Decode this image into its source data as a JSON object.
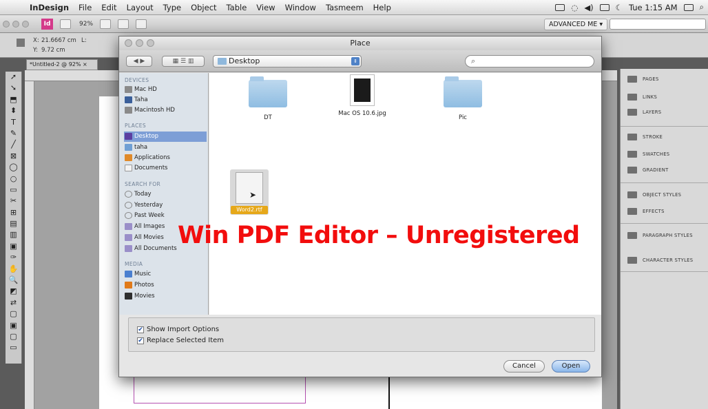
{
  "menubar": {
    "app_name": "InDesign",
    "items": [
      "File",
      "Edit",
      "Layout",
      "Type",
      "Object",
      "Table",
      "View",
      "Window",
      "Tasmeem",
      "Help"
    ],
    "clock": "Tue 1:15 AM"
  },
  "appbar": {
    "logo": "Id",
    "zoom": "92%",
    "workspace": "ADVANCED ME"
  },
  "control": {
    "x_label": "X:",
    "x_value": "21.6667 cm",
    "y_label": "Y:",
    "y_value": "9.72 cm",
    "l_label": "L:"
  },
  "document": {
    "tab_label": "*Untitled-2 @ 92%"
  },
  "toolbar": {
    "icons": [
      "selection-tool-icon",
      "direct-selection-tool-icon",
      "page-tool-icon",
      "gap-tool-icon",
      "type-tool-icon",
      "pencil-tool-icon",
      "line-tool-icon",
      "rectangle-frame-tool-icon",
      "ellipse-frame-tool-icon",
      "ellipse-tool-icon",
      "rectangle-tool-icon",
      "scissors-tool-icon",
      "free-transform-tool-icon",
      "gradient-swatch-tool-icon",
      "gradient-feather-tool-icon",
      "note-tool-icon",
      "eyedropper-tool-icon",
      "hand-tool-icon",
      "zoom-tool-icon",
      "fill-stroke-icon",
      "swap-icon",
      "apply-color-icon",
      "normal-view-icon",
      "preview-mode-icon",
      "screen-mode-icon"
    ],
    "glyphs": [
      "➚",
      "➘",
      "⬒",
      "⬍",
      "T",
      "✎",
      "╱",
      "⊠",
      "◯",
      "○",
      "▭",
      "✂",
      "⊞",
      "▤",
      "▥",
      "▣",
      "✑",
      "✋",
      "🔍",
      "◩",
      "⇄",
      "▢",
      "▣",
      "▢",
      "▭"
    ]
  },
  "panels": [
    {
      "label": "PAGES",
      "icon": "pages-icon"
    },
    {
      "label": "LINKS",
      "icon": "links-icon"
    },
    {
      "label": "LAYERS",
      "icon": "layers-icon"
    },
    {
      "label": "STROKE",
      "icon": "stroke-icon"
    },
    {
      "label": "SWATCHES",
      "icon": "swatches-icon"
    },
    {
      "label": "GRADIENT",
      "icon": "gradient-icon"
    },
    {
      "label": "OBJECT STYLES",
      "icon": "object-styles-icon"
    },
    {
      "label": "EFFECTS",
      "icon": "effects-icon"
    },
    {
      "label": "PARAGRAPH STYLES",
      "icon": "paragraph-styles-icon"
    },
    {
      "label": "CHARACTER STYLES",
      "icon": "character-styles-icon"
    }
  ],
  "dialog": {
    "title": "Place",
    "location": "Desktop",
    "search_placeholder": "",
    "sidebar": {
      "devices_header": "DEVICES",
      "devices": [
        "Mac HD",
        "Taha",
        "Macintosh HD"
      ],
      "places_header": "PLACES",
      "places": [
        "Desktop",
        "taha",
        "Applications",
        "Documents"
      ],
      "search_header": "SEARCH FOR",
      "search_items": [
        "Today",
        "Yesterday",
        "Past Week",
        "All Images",
        "All Movies",
        "All Documents"
      ],
      "media_header": "MEDIA",
      "media": [
        "Music",
        "Photos",
        "Movies"
      ]
    },
    "files": [
      {
        "name": "DT",
        "kind": "folder"
      },
      {
        "name": "Mac OS 10.6.jpg",
        "kind": "image"
      },
      {
        "name": "Pic",
        "kind": "folder"
      },
      {
        "name": "Word2.rtf",
        "kind": "document",
        "selected": true
      }
    ],
    "options": {
      "show_import": "Show Import Options",
      "show_import_checked": true,
      "replace_selected": "Replace Selected Item",
      "replace_selected_checked": true
    },
    "cancel_label": "Cancel",
    "open_label": "Open"
  },
  "watermark": "Win PDF Editor – Unregistered",
  "colors": {
    "watermark": "#f20d0d",
    "selection": "#7d9ed6",
    "file_label_highlight": "#e6a81a",
    "indesign_logo": "#d43a8a"
  }
}
